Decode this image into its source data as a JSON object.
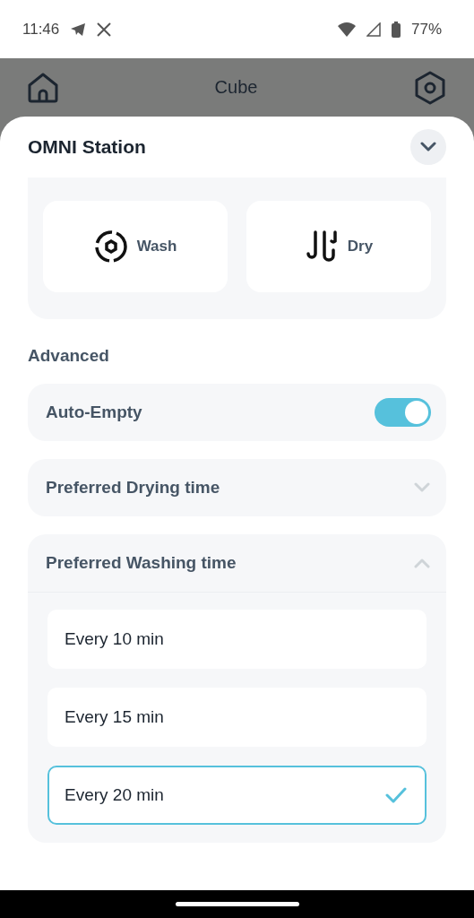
{
  "status_bar": {
    "time": "11:46",
    "battery": "77%"
  },
  "header": {
    "title": "Cube"
  },
  "sheet": {
    "title": "OMNI Station",
    "expanded": true,
    "actions": [
      {
        "kind": "wash",
        "label": "Wash"
      },
      {
        "kind": "dry",
        "label": "Dry"
      }
    ],
    "section_title": "Advanced",
    "settings": [
      {
        "kind": "toggle",
        "label": "Auto-Empty",
        "on": true
      },
      {
        "kind": "select",
        "label": "Preferred Drying time",
        "expanded": false
      },
      {
        "kind": "select",
        "label": "Preferred Washing time",
        "expanded": true,
        "options": [
          {
            "label": "Every 10 min",
            "selected": false
          },
          {
            "label": "Every 15 min",
            "selected": false
          },
          {
            "label": "Every 20 min",
            "selected": true
          }
        ]
      }
    ]
  }
}
